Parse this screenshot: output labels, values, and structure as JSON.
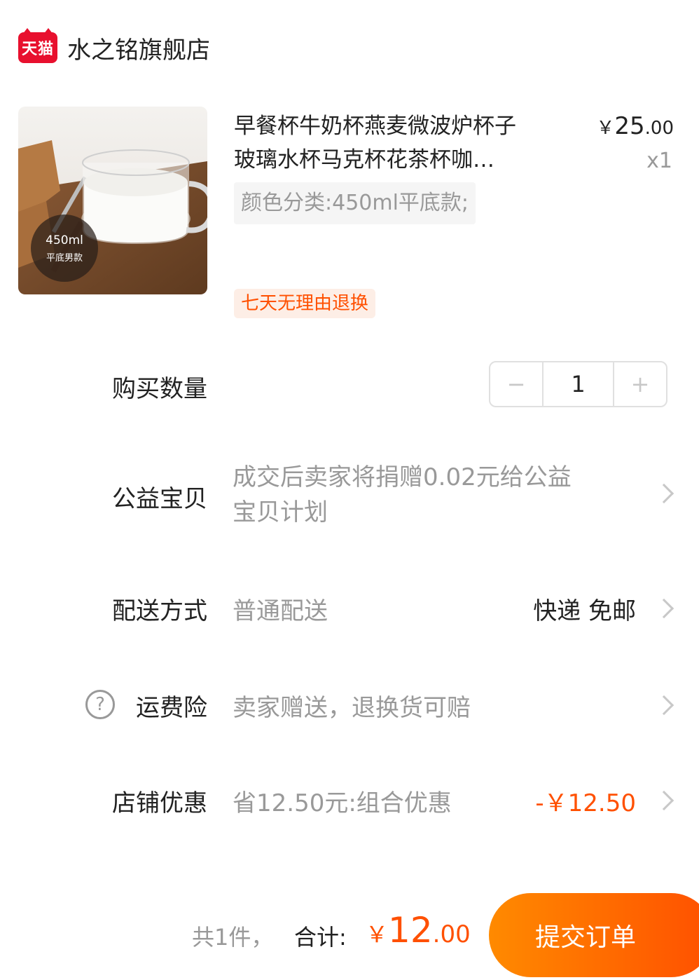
{
  "shop": {
    "logo_text": "天猫",
    "name": "水之铭旗舰店"
  },
  "product": {
    "title_line1": "早餐杯牛奶杯燕麦微波炉杯子",
    "title_line2": "玻璃水杯马克杯花茶杯咖…",
    "price_currency": "￥",
    "price_int": "25",
    "price_dec": ".00",
    "quantity_label": "x1",
    "sku": "颜色分类:450ml平底款;",
    "tag": "七天无理由退换",
    "image_badge_line1": "450ml",
    "image_badge_line2": "平底男款"
  },
  "rows": {
    "quantity": {
      "label": "购买数量",
      "minus": "−",
      "value": "1",
      "plus": "+"
    },
    "charity": {
      "label": "公益宝贝",
      "value_line1": "成交后卖家将捐赠0.02元给公益",
      "value_line2": "宝贝计划"
    },
    "delivery": {
      "label": "配送方式",
      "value": "普通配送",
      "right": "快递 免邮"
    },
    "insurance": {
      "label": "运费险",
      "help_icon": "?",
      "value": "卖家赠送，退换货可赔"
    },
    "store_discount": {
      "label": "店铺优惠",
      "value": "省12.50元:组合优惠",
      "right": "-￥12.50"
    }
  },
  "footer": {
    "count": "共1件，",
    "total_label": "合计:",
    "total_currency": "￥",
    "total_int": "12",
    "total_dec": ".00",
    "submit_label": "提交订单"
  },
  "colors": {
    "accent": "#ff5000",
    "tmall_red": "#e8102e",
    "muted": "#999999"
  }
}
